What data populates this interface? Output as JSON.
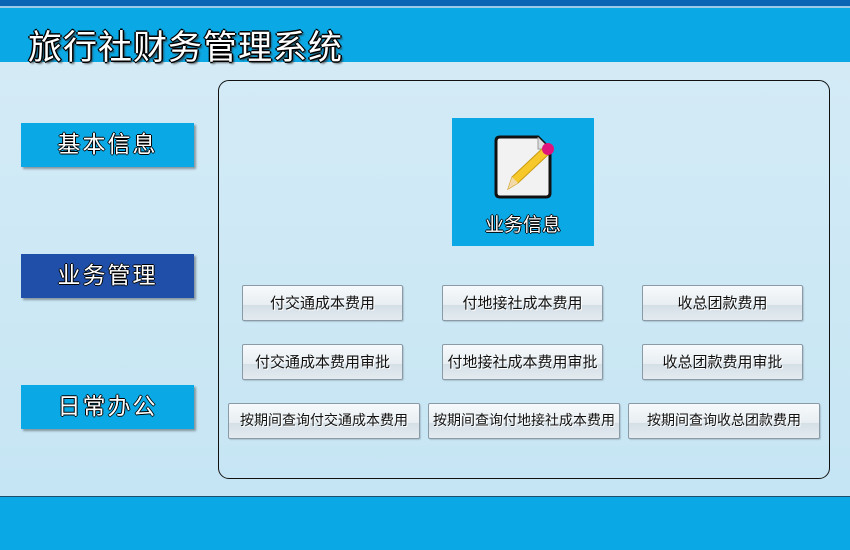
{
  "header": {
    "title": "旅行社财务管理系统"
  },
  "sidebar": {
    "items": [
      {
        "label": "基本信息",
        "active": false
      },
      {
        "label": "业务管理",
        "active": true
      },
      {
        "label": "日常办公",
        "active": false
      }
    ]
  },
  "main": {
    "tile": {
      "label": "业务信息",
      "icon": "document-edit-icon"
    },
    "buttons": [
      [
        "付交通成本费用",
        "付地接社成本费用",
        "收总团款费用"
      ],
      [
        "付交通成本费用审批",
        "付地接社成本费用审批",
        "收总团款费用审批"
      ],
      [
        "按期间查询付交通成本费用",
        "按期间查询付地接社成本费用",
        "按期间查询收总团款费用"
      ]
    ]
  },
  "colors": {
    "accent": "#0aa9e6",
    "active": "#1f4fa8"
  }
}
